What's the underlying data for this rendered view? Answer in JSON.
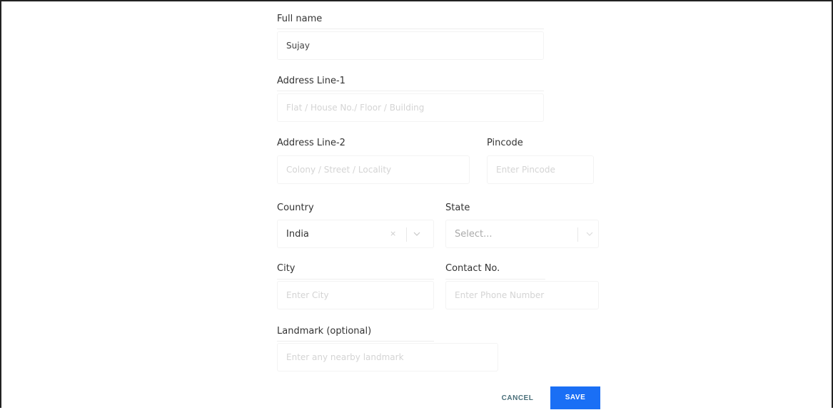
{
  "form": {
    "full_name": {
      "label": "Full name",
      "value": "Sujay"
    },
    "address_line_1": {
      "label": "Address Line-1",
      "placeholder": "Flat / House No./ Floor / Building"
    },
    "address_line_2": {
      "label": "Address Line-2",
      "placeholder": "Colony / Street / Locality"
    },
    "pincode": {
      "label": "Pincode",
      "placeholder": "Enter Pincode"
    },
    "country": {
      "label": "Country",
      "value": "India",
      "clear_glyph": "×"
    },
    "state": {
      "label": "State",
      "placeholder": "Select..."
    },
    "city": {
      "label": "City",
      "placeholder": "Enter City"
    },
    "contact_no": {
      "label": "Contact No.",
      "placeholder": "Enter Phone Number"
    },
    "landmark": {
      "label": "Landmark (optional)",
      "placeholder": "Enter any nearby landmark"
    }
  },
  "actions": {
    "cancel_label": "CANCEL",
    "save_label": "SAVE"
  },
  "colors": {
    "save_bg": "#1a6ff5",
    "cancel_text": "#4a6f7a",
    "frame_border": "#222222"
  }
}
